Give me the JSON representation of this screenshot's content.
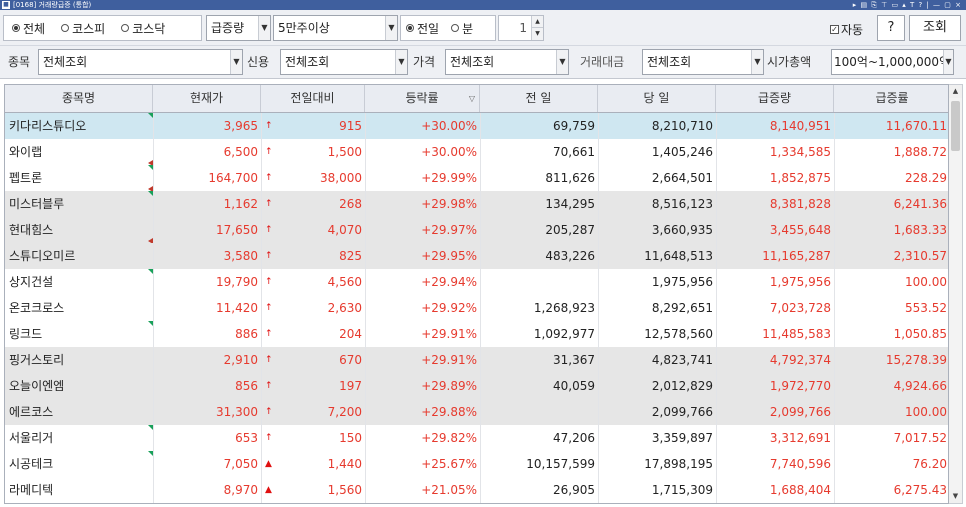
{
  "window": {
    "title": "[0168] 거래량급증 (통합)",
    "controls": "▸ ▤ ⎘ ⊤ ▭ ▴ T ? | — ▢ ×"
  },
  "toolbar": {
    "market_radios": [
      {
        "label": "전체",
        "selected": true
      },
      {
        "label": "코스피",
        "selected": false
      },
      {
        "label": "코스닥",
        "selected": false
      }
    ],
    "mode_select": "급증량",
    "volume_select": "5만주이상",
    "period_radios": [
      {
        "label": "전일",
        "selected": true
      },
      {
        "label": "분",
        "selected": false
      }
    ],
    "minute_value": "1",
    "auto_label": "자동",
    "auto_checked": true,
    "help_label": "?",
    "query_label": "조회"
  },
  "filters": {
    "stock_label": "종목",
    "stock_value": "전체조회",
    "credit_label": "신용",
    "credit_value": "전체조회",
    "price_label": "가격",
    "price_value": "전체조회",
    "amount_label": "거래대금",
    "amount_value": "전체조회",
    "cap_label": "시가총액",
    "cap_value": "100억~1,000,000억"
  },
  "table": {
    "columns": [
      "종목명",
      "현재가",
      "전일대비",
      "등락률",
      "전 일",
      "당 일",
      "급증량",
      "급증률"
    ],
    "sort_marker": "▽",
    "rows": [
      {
        "name": "키다리스튜디오",
        "price": "3,965",
        "dir": "↑",
        "change": "915",
        "rate": "+30.00%",
        "prev": "69,759",
        "today": "8,210,710",
        "surge": "8,140,951",
        "surge_rate": "11,670.11",
        "bg": "sel",
        "green": true,
        "redmark": false
      },
      {
        "name": "와이랩",
        "price": "6,500",
        "dir": "↑",
        "change": "1,500",
        "rate": "+30.00%",
        "prev": "70,661",
        "today": "1,405,246",
        "surge": "1,334,585",
        "surge_rate": "1,888.72",
        "bg": "white",
        "green": false,
        "redmark": true
      },
      {
        "name": "펩트론",
        "price": "164,700",
        "dir": "↑",
        "change": "38,000",
        "rate": "+29.99%",
        "prev": "811,626",
        "today": "2,664,501",
        "surge": "1,852,875",
        "surge_rate": "228.29",
        "bg": "white",
        "green": true,
        "redmark": true
      },
      {
        "name": "미스터블루",
        "price": "1,162",
        "dir": "↑",
        "change": "268",
        "rate": "+29.98%",
        "prev": "134,295",
        "today": "8,516,123",
        "surge": "8,381,828",
        "surge_rate": "6,241.36",
        "bg": "alt",
        "green": true,
        "redmark": false
      },
      {
        "name": "현대힘스",
        "price": "17,650",
        "dir": "↑",
        "change": "4,070",
        "rate": "+29.97%",
        "prev": "205,287",
        "today": "3,660,935",
        "surge": "3,455,648",
        "surge_rate": "1,683.33",
        "bg": "alt",
        "green": false,
        "redmark": true
      },
      {
        "name": "스튜디오미르",
        "price": "3,580",
        "dir": "↑",
        "change": "825",
        "rate": "+29.95%",
        "prev": "483,226",
        "today": "11,648,513",
        "surge": "11,165,287",
        "surge_rate": "2,310.57",
        "bg": "alt",
        "green": false,
        "redmark": false
      },
      {
        "name": "상지건설",
        "price": "19,790",
        "dir": "↑",
        "change": "4,560",
        "rate": "+29.94%",
        "prev": "",
        "today": "1,975,956",
        "surge": "1,975,956",
        "surge_rate": "100.00",
        "bg": "white",
        "green": true,
        "redmark": false
      },
      {
        "name": "온코크로스",
        "price": "11,420",
        "dir": "↑",
        "change": "2,630",
        "rate": "+29.92%",
        "prev": "1,268,923",
        "today": "8,292,651",
        "surge": "7,023,728",
        "surge_rate": "553.52",
        "bg": "white",
        "green": false,
        "redmark": false
      },
      {
        "name": "링크드",
        "price": "886",
        "dir": "↑",
        "change": "204",
        "rate": "+29.91%",
        "prev": "1,092,977",
        "today": "12,578,560",
        "surge": "11,485,583",
        "surge_rate": "1,050.85",
        "bg": "white",
        "green": true,
        "redmark": false
      },
      {
        "name": "핑거스토리",
        "price": "2,910",
        "dir": "↑",
        "change": "670",
        "rate": "+29.91%",
        "prev": "31,367",
        "today": "4,823,741",
        "surge": "4,792,374",
        "surge_rate": "15,278.39",
        "bg": "alt",
        "green": false,
        "redmark": false
      },
      {
        "name": "오늘이엔엠",
        "price": "856",
        "dir": "↑",
        "change": "197",
        "rate": "+29.89%",
        "prev": "40,059",
        "today": "2,012,829",
        "surge": "1,972,770",
        "surge_rate": "4,924.66",
        "bg": "alt",
        "green": false,
        "redmark": false
      },
      {
        "name": "에르코스",
        "price": "31,300",
        "dir": "↑",
        "change": "7,200",
        "rate": "+29.88%",
        "prev": "",
        "today": "2,099,766",
        "surge": "2,099,766",
        "surge_rate": "100.00",
        "bg": "alt",
        "green": false,
        "redmark": false
      },
      {
        "name": "서울리거",
        "price": "653",
        "dir": "↑",
        "change": "150",
        "rate": "+29.82%",
        "prev": "47,206",
        "today": "3,359,897",
        "surge": "3,312,691",
        "surge_rate": "7,017.52",
        "bg": "white",
        "green": true,
        "redmark": false
      },
      {
        "name": "시공테크",
        "price": "7,050",
        "dir": "▲",
        "change": "1,440",
        "rate": "+25.67%",
        "prev": "10,157,599",
        "today": "17,898,195",
        "surge": "7,740,596",
        "surge_rate": "76.20",
        "bg": "white",
        "green": true,
        "redmark": false
      },
      {
        "name": "라메디텍",
        "price": "8,970",
        "dir": "▲",
        "change": "1,560",
        "rate": "+21.05%",
        "prev": "26,905",
        "today": "1,715,309",
        "surge": "1,688,404",
        "surge_rate": "6,275.43",
        "bg": "white",
        "green": false,
        "redmark": false
      }
    ]
  },
  "colors": {
    "up": "#e63a2e",
    "selected_row": "#cfe7f1",
    "alt_row": "#e6e6e6",
    "header": "#e9ecf2",
    "titlebar": "#3f5f9e"
  }
}
